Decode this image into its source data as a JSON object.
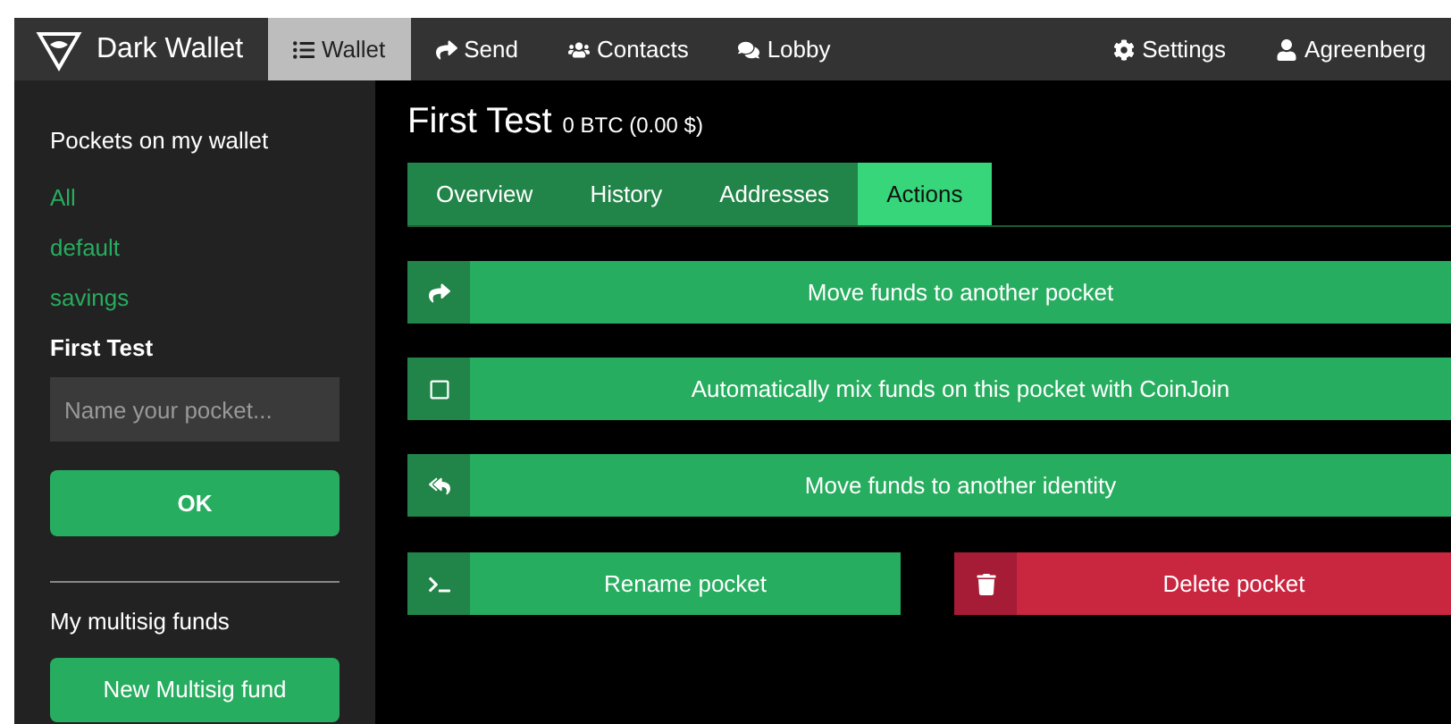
{
  "brand": {
    "name": "Dark Wallet"
  },
  "nav": [
    {
      "label": "Wallet",
      "selected": true
    },
    {
      "label": "Send",
      "selected": false
    },
    {
      "label": "Contacts",
      "selected": false
    },
    {
      "label": "Lobby",
      "selected": false
    }
  ],
  "nav_right": [
    {
      "label": "Settings"
    },
    {
      "label": "Agreenberg"
    }
  ],
  "sidebar": {
    "title": "Pockets on my wallet",
    "pockets": [
      {
        "label": "All",
        "selected": false
      },
      {
        "label": "default",
        "selected": false
      },
      {
        "label": "savings",
        "selected": false
      },
      {
        "label": "First Test",
        "selected": true
      }
    ],
    "name_field": {
      "placeholder": "Name your pocket..."
    },
    "ok_button": "OK",
    "multisig_title": "My multisig funds",
    "multisig_button": "New Multisig fund"
  },
  "pocket": {
    "name": "First Test",
    "balance": "0 BTC (0.00 $)"
  },
  "tabs": [
    {
      "label": "Overview",
      "selected": false
    },
    {
      "label": "History",
      "selected": false
    },
    {
      "label": "Addresses",
      "selected": false
    },
    {
      "label": "Actions",
      "selected": true
    }
  ],
  "actions": [
    {
      "label": "Move funds to another pocket",
      "kind": "share"
    },
    {
      "label": "Automatically mix funds on this pocket with CoinJoin",
      "kind": "checkbox",
      "checked": false
    },
    {
      "label": "Move funds to another identity",
      "kind": "reply"
    }
  ],
  "bottom_actions": [
    {
      "label": "Rename pocket",
      "kind": "terminal",
      "danger": false
    },
    {
      "label": "Delete pocket",
      "kind": "trash",
      "danger": true
    }
  ]
}
